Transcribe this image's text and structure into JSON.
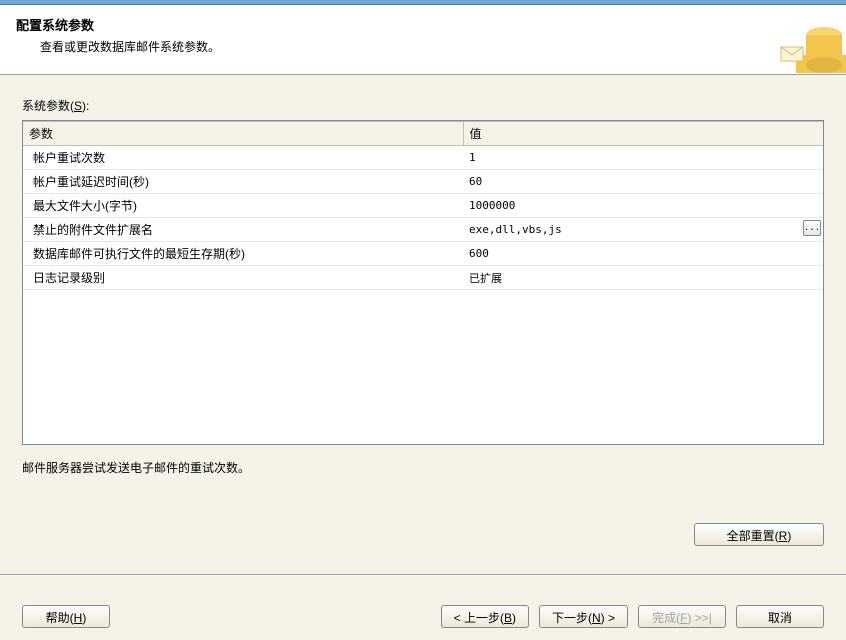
{
  "header": {
    "title": "配置系统参数",
    "subtitle": "查看或更改数据库邮件系统参数。"
  },
  "section": {
    "label_prefix": "系统参数(",
    "label_hotkey": "S",
    "label_suffix": "):"
  },
  "grid": {
    "headers": {
      "param": "参数",
      "value": "值"
    },
    "rows": [
      {
        "param": "帐户重试次数",
        "value": "1",
        "has_button": false
      },
      {
        "param": "帐户重试延迟时间(秒)",
        "value": "60",
        "has_button": false
      },
      {
        "param": "最大文件大小(字节)",
        "value": "1000000",
        "has_button": false
      },
      {
        "param": "禁止的附件文件扩展名",
        "value": "exe,dll,vbs,js",
        "has_button": true
      },
      {
        "param": "数据库邮件可执行文件的最短生存期(秒)",
        "value": "600",
        "has_button": false
      },
      {
        "param": "日志记录级别",
        "value": "已扩展",
        "has_button": false
      }
    ]
  },
  "description": "邮件服务器尝试发送电子邮件的重试次数。",
  "buttons": {
    "reset_all_prefix": "全部重置(",
    "reset_all_hotkey": "R",
    "reset_all_suffix": ")",
    "help_prefix": "帮助(",
    "help_hotkey": "H",
    "help_suffix": ")",
    "back_prefix": "< 上一步(",
    "back_hotkey": "B",
    "back_suffix": ")",
    "next_prefix": "下一步(",
    "next_hotkey": "N",
    "next_suffix": ") >",
    "finish_prefix": "完成(",
    "finish_hotkey": "F",
    "finish_suffix": ") >>|",
    "cancel": "取消"
  }
}
